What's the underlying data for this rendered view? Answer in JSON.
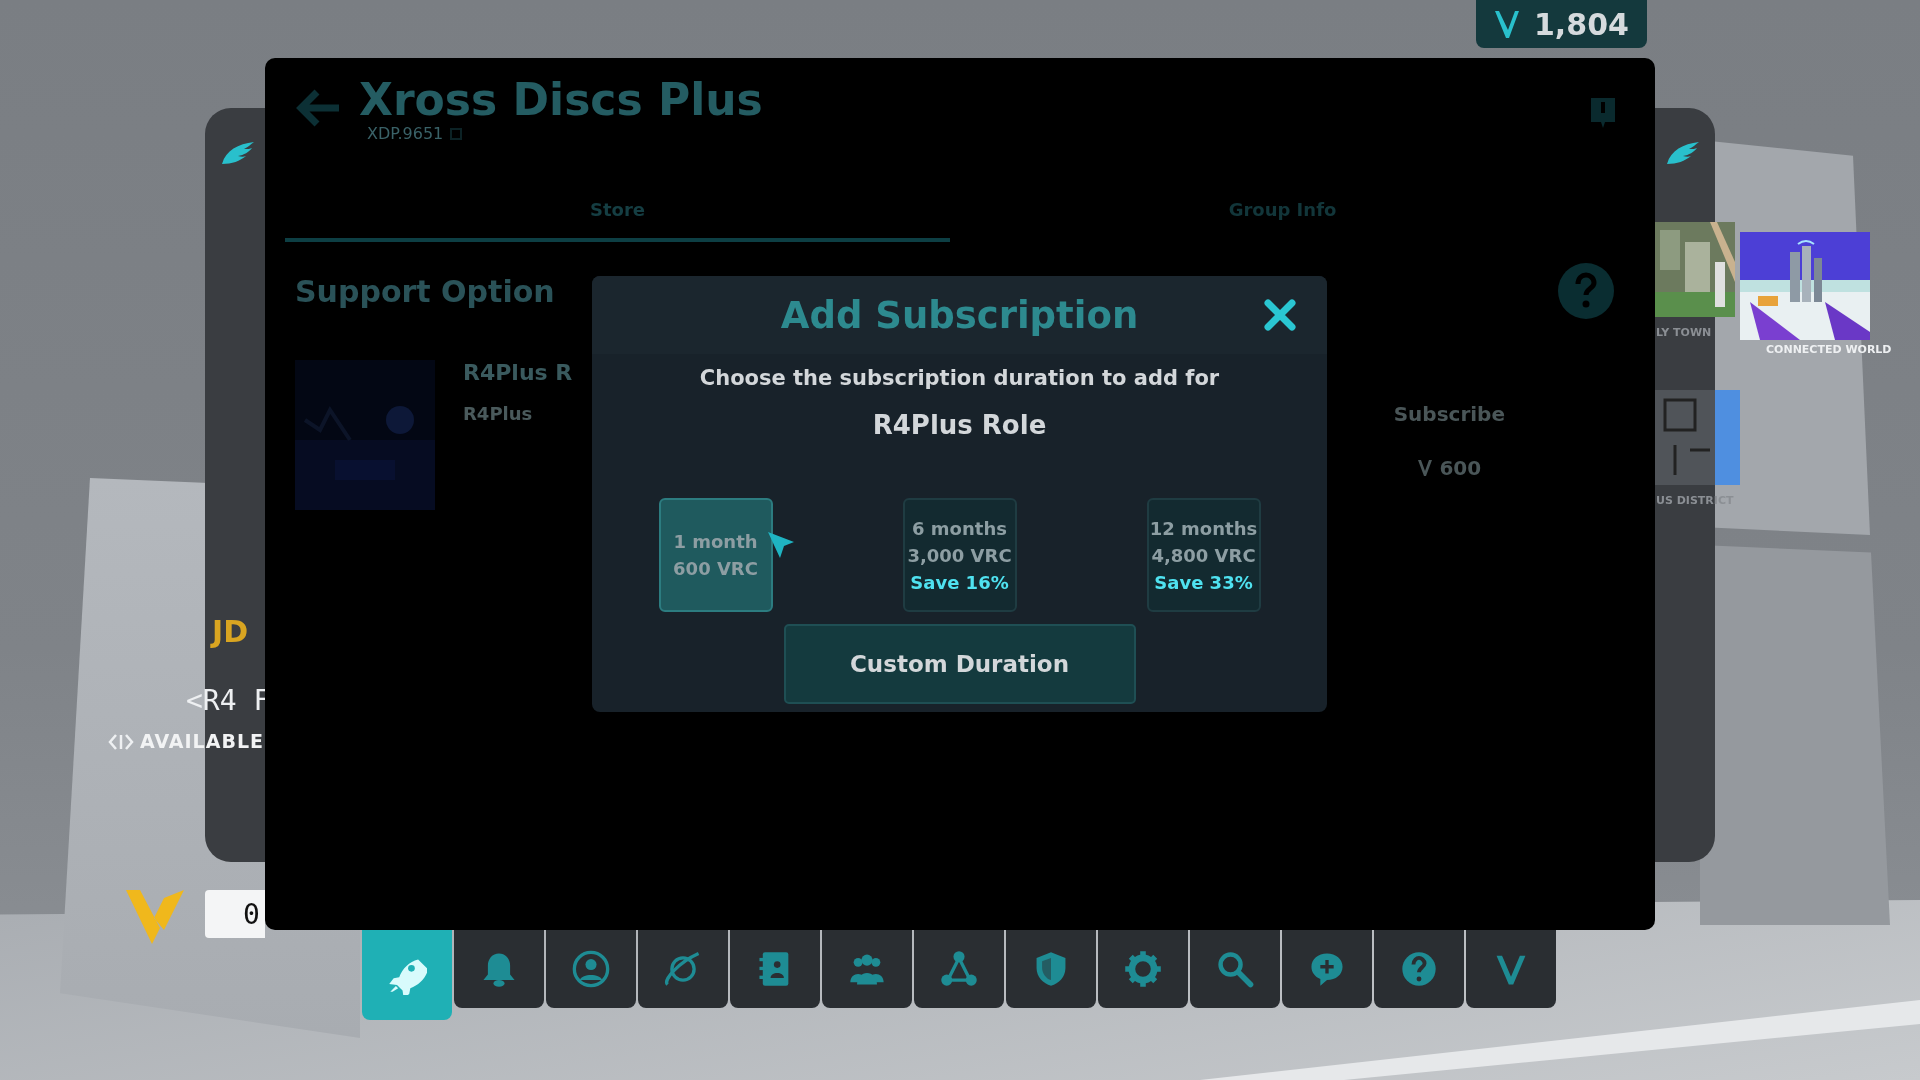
{
  "balance": {
    "amount": "1,804"
  },
  "window": {
    "title": "Xross Discs Plus",
    "group_code": "XDP.9651",
    "tabs": [
      {
        "label": "Store",
        "selected": true
      },
      {
        "label": "Group Info",
        "selected": false
      }
    ],
    "section_title": "Support Option",
    "product": {
      "name": "R4Plus R",
      "subtitle": "R4Plus",
      "action": "Subscribe",
      "price": "600"
    }
  },
  "dialog": {
    "title": "Add Subscription",
    "prompt": "Choose the subscription duration to add for",
    "role": "R4Plus Role",
    "options": [
      {
        "duration": "1 month",
        "price": "600 VRC",
        "selected": true
      },
      {
        "duration": "6 months",
        "price": "3,000 VRC",
        "saving": "Save 16%",
        "selected": false
      },
      {
        "duration": "12 months",
        "price": "4,800 VRC",
        "saving": "Save 33%",
        "selected": false
      }
    ],
    "custom_button": "Custom Duration"
  },
  "left_panel": {
    "sign_text": "<R4 F",
    "status": "AVAILABLE",
    "logo_text": "JD",
    "field_value": "0"
  },
  "right_panel": {
    "worlds": [
      {
        "name": "LY TOWN"
      },
      {
        "name": "CONNECTED WORLD"
      },
      {
        "name": "US DISTRICT"
      }
    ]
  },
  "toolbar": [
    {
      "kind": "rocket",
      "selected": true
    },
    {
      "kind": "bell",
      "selected": false
    },
    {
      "kind": "person",
      "selected": false
    },
    {
      "kind": "planet",
      "selected": false
    },
    {
      "kind": "book",
      "selected": false
    },
    {
      "kind": "people",
      "selected": false
    },
    {
      "kind": "network",
      "selected": false
    },
    {
      "kind": "shield",
      "selected": false
    },
    {
      "kind": "gear",
      "selected": false
    },
    {
      "kind": "search",
      "selected": false
    },
    {
      "kind": "chat",
      "selected": false
    },
    {
      "kind": "help",
      "selected": false
    },
    {
      "kind": "logo",
      "selected": false
    }
  ]
}
